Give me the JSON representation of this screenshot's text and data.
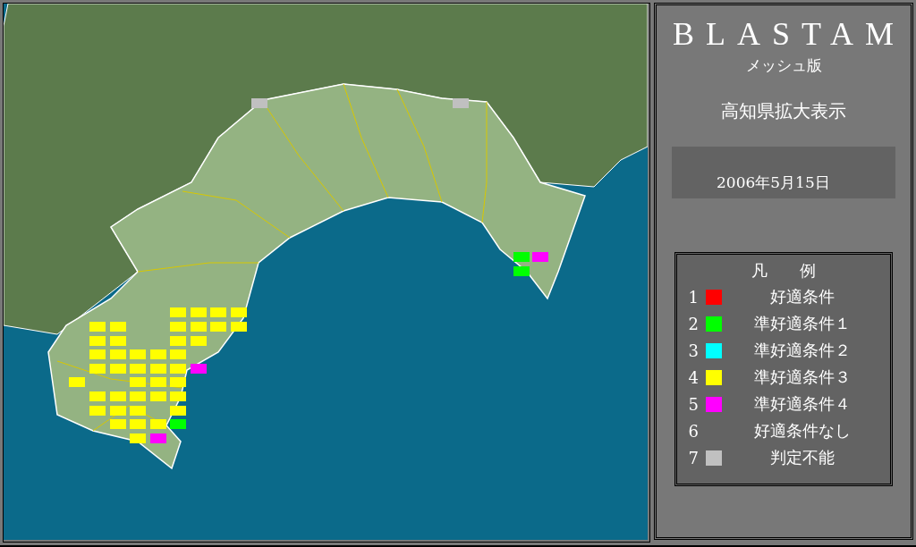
{
  "panel": {
    "title": "BLASTAM",
    "subtitle": "メッシュ版",
    "region": "高知県拡大表示",
    "date": "2006年5月15日"
  },
  "legend": {
    "title": "凡　　例",
    "items": [
      {
        "number": "1",
        "color": "#ff0000",
        "label": "好適条件"
      },
      {
        "number": "2",
        "color": "#00ff00",
        "label": "準好適条件１"
      },
      {
        "number": "3",
        "color": "#00ffff",
        "label": "準好適条件２"
      },
      {
        "number": "4",
        "color": "#ffff00",
        "label": "準好適条件３"
      },
      {
        "number": "5",
        "color": "#ff00ff",
        "label": "準好適条件４"
      },
      {
        "number": "6",
        "label": "好適条件なし"
      },
      {
        "number": "7",
        "color": "#c0c0c0",
        "label": "判定不能"
      }
    ]
  }
}
